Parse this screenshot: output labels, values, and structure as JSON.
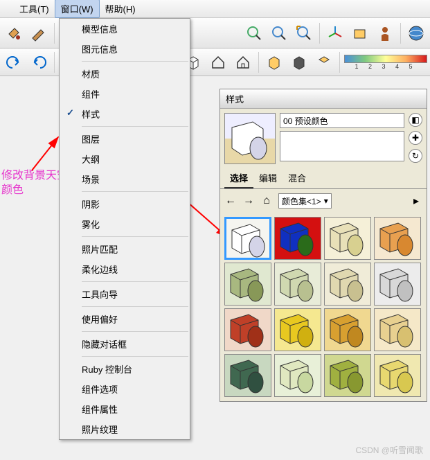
{
  "menu": {
    "tools": "工具(T)",
    "window": "窗口(W)",
    "help": "帮助(H)"
  },
  "dropdown": {
    "model_info": "模型信息",
    "element_info": "图元信息",
    "material": "材质",
    "component": "组件",
    "style": "样式",
    "layer": "图层",
    "outline": "大纲",
    "scene": "场景",
    "shadow": "阴影",
    "fog": "雾化",
    "photo_match": "照片匹配",
    "soften": "柔化边线",
    "tool_guide": "工具向导",
    "preferences": "使用偏好",
    "hide_dialog": "隐藏对话框",
    "ruby": "Ruby 控制台",
    "comp_options": "组件选项",
    "comp_attrs": "组件属性",
    "photo_texture": "照片纹理"
  },
  "annotation": {
    "line1": "修改背景天空",
    "line2": "颜色"
  },
  "panel": {
    "title": "样式",
    "preset_name": "00 预设颜色",
    "tabs": {
      "select": "选择",
      "edit": "编辑",
      "mix": "混合"
    },
    "combo": "颜色集<1>",
    "ruler": "1 2 3 4 5"
  },
  "swatches": [
    {
      "bg": "#f5f5f0",
      "box": "#ffffff",
      "cyl": "#d4d4e8",
      "sel": true
    },
    {
      "bg": "#d41010",
      "box": "#1030c0",
      "cyl": "#2a6b1a",
      "sel": false
    },
    {
      "bg": "#f5f0d8",
      "box": "#e8e0b8",
      "cyl": "#d8d090",
      "sel": false
    },
    {
      "bg": "#f5e8d0",
      "box": "#e8a050",
      "cyl": "#d88830",
      "sel": false
    },
    {
      "bg": "#e0e8d0",
      "box": "#a8b880",
      "cyl": "#889858",
      "sel": false
    },
    {
      "bg": "#e8ecd8",
      "box": "#d0d8b0",
      "cyl": "#b8c090",
      "sel": false
    },
    {
      "bg": "#f0ecd8",
      "box": "#e0d8b0",
      "cyl": "#c8c090",
      "sel": false
    },
    {
      "bg": "#ececec",
      "box": "#d8d8d8",
      "cyl": "#c0c0c0",
      "sel": false
    },
    {
      "bg": "#f0d8c8",
      "box": "#c04028",
      "cyl": "#a03018",
      "sel": false
    },
    {
      "bg": "#f5e890",
      "box": "#e8c820",
      "cyl": "#d0b010",
      "sel": false
    },
    {
      "bg": "#f0d890",
      "box": "#d8a030",
      "cyl": "#c08820",
      "sel": false
    },
    {
      "bg": "#f5e8c8",
      "box": "#e8d090",
      "cyl": "#d8c070",
      "sel": false
    },
    {
      "bg": "#c8d8c0",
      "box": "#406850",
      "cyl": "#305040",
      "sel": false
    },
    {
      "bg": "#e8f0d8",
      "box": "#e0e8c0",
      "cyl": "#c8d8a0",
      "sel": false
    },
    {
      "bg": "#d0d890",
      "box": "#a0b040",
      "cyl": "#889830",
      "sel": false
    },
    {
      "bg": "#f0e8b0",
      "box": "#e8d870",
      "cyl": "#d8c850",
      "sel": false
    }
  ],
  "watermark": "CSDN @听雪闻歌"
}
